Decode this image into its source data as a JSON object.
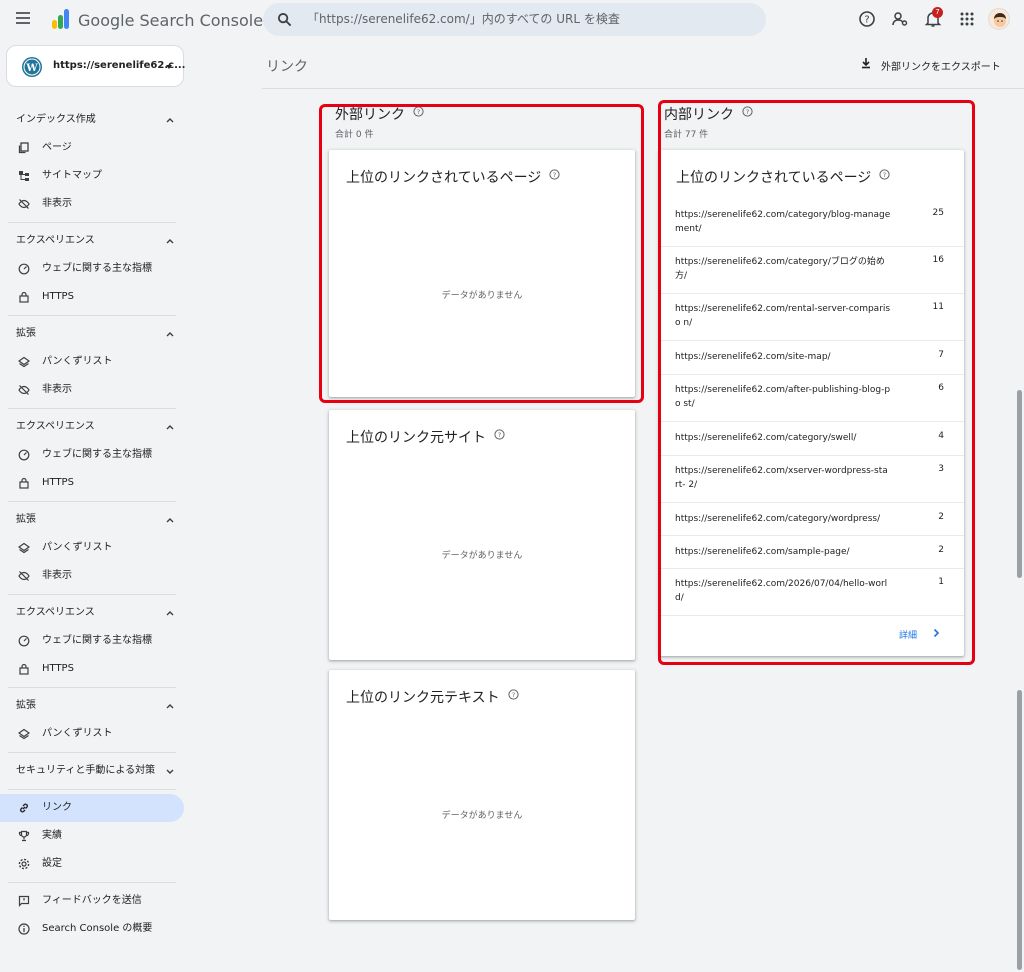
{
  "app": {
    "name": "Google Search Console"
  },
  "search": {
    "placeholder": "「https://serenelife62.com/」内のすべての URL を検査"
  },
  "topbar": {
    "notification_count": "7"
  },
  "property": {
    "label": "https://serenelife62.c..."
  },
  "sidebar": {
    "sections": [
      {
        "title": "インデックス作成",
        "items": [
          {
            "label": "ページ",
            "icon": "pages-icon"
          },
          {
            "label": "サイトマップ",
            "icon": "sitemap-icon"
          },
          {
            "label": "非表示",
            "icon": "eye-off-icon"
          }
        ]
      },
      {
        "title": "エクスペリエンス",
        "items": [
          {
            "label": "ウェブに関する主な指標",
            "icon": "gauge-icon"
          },
          {
            "label": "HTTPS",
            "icon": "lock-icon"
          }
        ]
      },
      {
        "title": "拡張",
        "items": [
          {
            "label": "パンくずリスト",
            "icon": "layers-icon"
          },
          {
            "label": "非表示",
            "icon": "eye-off-icon"
          }
        ]
      },
      {
        "title": "エクスペリエンス",
        "items": [
          {
            "label": "ウェブに関する主な指標",
            "icon": "gauge-icon"
          },
          {
            "label": "HTTPS",
            "icon": "lock-icon"
          }
        ]
      },
      {
        "title": "拡張",
        "items": [
          {
            "label": "パンくずリスト",
            "icon": "layers-icon"
          },
          {
            "label": "非表示",
            "icon": "eye-off-icon"
          }
        ]
      },
      {
        "title": "エクスペリエンス",
        "items": [
          {
            "label": "ウェブに関する主な指標",
            "icon": "gauge-icon"
          },
          {
            "label": "HTTPS",
            "icon": "lock-icon"
          }
        ]
      },
      {
        "title": "拡張",
        "items": [
          {
            "label": "パンくずリスト",
            "icon": "layers-icon"
          }
        ]
      }
    ],
    "security": "セキュリティと手動による対策",
    "links": "リンク",
    "achievements": "実績",
    "settings": "設定",
    "feedback": "フィードバックを送信",
    "about": "Search Console の概要"
  },
  "main": {
    "title": "リンク",
    "export_label": "外部リンクをエクスポート",
    "external": {
      "title": "外部リンク",
      "total": "合計 0 件",
      "cards": [
        {
          "title": "上位のリンクされているページ",
          "empty": "データがありません"
        },
        {
          "title": "上位のリンク元サイト",
          "empty": "データがありません"
        },
        {
          "title": "上位のリンク元テキスト",
          "empty": "データがありません"
        }
      ]
    },
    "internal": {
      "title": "内部リンク",
      "total": "合計 77 件",
      "card_title": "上位のリンクされているページ",
      "rows": [
        {
          "url": "https://serenelife62.com/category/blog-manage ment/",
          "count": "25"
        },
        {
          "url": "https://serenelife62.com/category/ブログの始め 方/",
          "count": "16"
        },
        {
          "url": "https://serenelife62.com/rental-server-compariso n/",
          "count": "11"
        },
        {
          "url": "https://serenelife62.com/site-map/",
          "count": "7"
        },
        {
          "url": "https://serenelife62.com/after-publishing-blog-po st/",
          "count": "6"
        },
        {
          "url": "https://serenelife62.com/category/swell/",
          "count": "4"
        },
        {
          "url": "https://serenelife62.com/xserver-wordpress-start- 2/",
          "count": "3"
        },
        {
          "url": "https://serenelife62.com/category/wordpress/",
          "count": "2"
        },
        {
          "url": "https://serenelife62.com/sample-page/",
          "count": "2"
        },
        {
          "url": "https://serenelife62.com/2026/07/04/hello-worl d/",
          "count": "1"
        }
      ],
      "details": "詳細"
    }
  },
  "colors": {
    "accent": "#1a73e8",
    "highlight": "#e60012",
    "active_nav": "#d3e3fd"
  }
}
